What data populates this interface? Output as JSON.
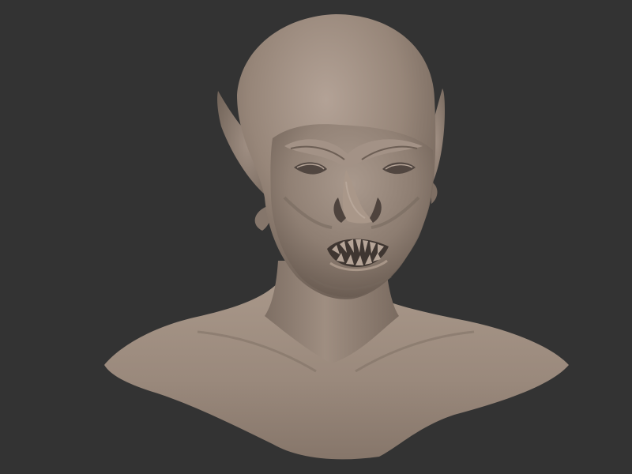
{
  "scene": {
    "background_color": "#333333",
    "material_color": "#9a8a7e",
    "subject": "sculpted-creature-bust"
  }
}
